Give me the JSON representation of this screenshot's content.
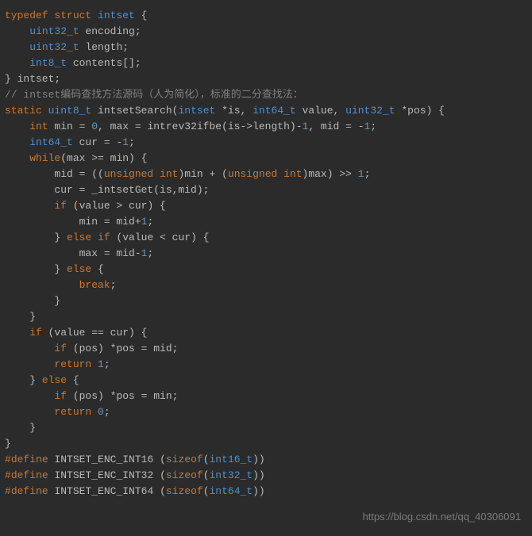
{
  "code": {
    "lines": [
      {
        "segments": [
          {
            "t": "typedef",
            "c": "kw"
          },
          {
            "t": " ",
            "c": "id"
          },
          {
            "t": "struct",
            "c": "kw"
          },
          {
            "t": " ",
            "c": "id"
          },
          {
            "t": "intset",
            "c": "typ"
          },
          {
            "t": " {",
            "c": "punc"
          }
        ]
      },
      {
        "segments": [
          {
            "t": "    ",
            "c": "id"
          },
          {
            "t": "uint32_t",
            "c": "typ"
          },
          {
            "t": " encoding;",
            "c": "id"
          }
        ]
      },
      {
        "segments": [
          {
            "t": "    ",
            "c": "id"
          },
          {
            "t": "uint32_t",
            "c": "typ"
          },
          {
            "t": " length;",
            "c": "id"
          }
        ]
      },
      {
        "segments": [
          {
            "t": "    ",
            "c": "id"
          },
          {
            "t": "int8_t",
            "c": "typ"
          },
          {
            "t": " contents[];",
            "c": "id"
          }
        ]
      },
      {
        "segments": [
          {
            "t": "} intset;",
            "c": "id"
          }
        ]
      },
      {
        "segments": [
          {
            "t": "",
            "c": "id"
          }
        ]
      },
      {
        "segments": [
          {
            "t": "// intset编码查找方法源码（人为简化），标准的二分查找法：",
            "c": "cmt"
          }
        ]
      },
      {
        "segments": [
          {
            "t": "static",
            "c": "kw"
          },
          {
            "t": " ",
            "c": "id"
          },
          {
            "t": "uint8_t",
            "c": "typ"
          },
          {
            "t": " ",
            "c": "id"
          },
          {
            "t": "intsetSearch",
            "c": "id"
          },
          {
            "t": "(",
            "c": "punc"
          },
          {
            "t": "intset",
            "c": "typ"
          },
          {
            "t": " *is, ",
            "c": "id"
          },
          {
            "t": "int64_t",
            "c": "typ"
          },
          {
            "t": " value, ",
            "c": "id"
          },
          {
            "t": "uint32_t",
            "c": "typ"
          },
          {
            "t": " *pos) {",
            "c": "id"
          }
        ]
      },
      {
        "segments": [
          {
            "t": "    ",
            "c": "id"
          },
          {
            "t": "int",
            "c": "kw"
          },
          {
            "t": " min = ",
            "c": "id"
          },
          {
            "t": "0",
            "c": "num"
          },
          {
            "t": ", max = intrev32ifbe(is->length)-",
            "c": "id"
          },
          {
            "t": "1",
            "c": "num"
          },
          {
            "t": ", mid = -",
            "c": "id"
          },
          {
            "t": "1",
            "c": "num"
          },
          {
            "t": ";",
            "c": "id"
          }
        ]
      },
      {
        "segments": [
          {
            "t": "    ",
            "c": "id"
          },
          {
            "t": "int64_t",
            "c": "typ"
          },
          {
            "t": " cur = -",
            "c": "id"
          },
          {
            "t": "1",
            "c": "num"
          },
          {
            "t": ";",
            "c": "id"
          }
        ]
      },
      {
        "segments": [
          {
            "t": "",
            "c": "id"
          }
        ]
      },
      {
        "segments": [
          {
            "t": "    ",
            "c": "id"
          },
          {
            "t": "while",
            "c": "ctrl"
          },
          {
            "t": "(max >= min) {",
            "c": "id"
          }
        ]
      },
      {
        "segments": [
          {
            "t": "        mid = ((",
            "c": "id"
          },
          {
            "t": "unsigned",
            "c": "kw"
          },
          {
            "t": " ",
            "c": "id"
          },
          {
            "t": "int",
            "c": "kw"
          },
          {
            "t": ")min + (",
            "c": "id"
          },
          {
            "t": "unsigned",
            "c": "kw"
          },
          {
            "t": " ",
            "c": "id"
          },
          {
            "t": "int",
            "c": "kw"
          },
          {
            "t": ")max) >> ",
            "c": "id"
          },
          {
            "t": "1",
            "c": "num"
          },
          {
            "t": ";",
            "c": "id"
          }
        ]
      },
      {
        "segments": [
          {
            "t": "        cur = _intsetGet(is,mid);",
            "c": "id"
          }
        ]
      },
      {
        "segments": [
          {
            "t": "        ",
            "c": "id"
          },
          {
            "t": "if",
            "c": "ctrl"
          },
          {
            "t": " (value > cur) {",
            "c": "id"
          }
        ]
      },
      {
        "segments": [
          {
            "t": "            min = mid+",
            "c": "id"
          },
          {
            "t": "1",
            "c": "num"
          },
          {
            "t": ";",
            "c": "id"
          }
        ]
      },
      {
        "segments": [
          {
            "t": "        } ",
            "c": "id"
          },
          {
            "t": "else",
            "c": "ctrl"
          },
          {
            "t": " ",
            "c": "id"
          },
          {
            "t": "if",
            "c": "ctrl"
          },
          {
            "t": " (value < cur) {",
            "c": "id"
          }
        ]
      },
      {
        "segments": [
          {
            "t": "            max = mid-",
            "c": "id"
          },
          {
            "t": "1",
            "c": "num"
          },
          {
            "t": ";",
            "c": "id"
          }
        ]
      },
      {
        "segments": [
          {
            "t": "        } ",
            "c": "id"
          },
          {
            "t": "else",
            "c": "ctrl"
          },
          {
            "t": " {",
            "c": "id"
          }
        ]
      },
      {
        "segments": [
          {
            "t": "            ",
            "c": "id"
          },
          {
            "t": "break",
            "c": "ctrl"
          },
          {
            "t": ";",
            "c": "id"
          }
        ]
      },
      {
        "segments": [
          {
            "t": "        }",
            "c": "id"
          }
        ]
      },
      {
        "segments": [
          {
            "t": "    }",
            "c": "id"
          }
        ]
      },
      {
        "segments": [
          {
            "t": "",
            "c": "id"
          }
        ]
      },
      {
        "segments": [
          {
            "t": "    ",
            "c": "id"
          },
          {
            "t": "if",
            "c": "ctrl"
          },
          {
            "t": " (value == cur) {",
            "c": "id"
          }
        ]
      },
      {
        "segments": [
          {
            "t": "        ",
            "c": "id"
          },
          {
            "t": "if",
            "c": "ctrl"
          },
          {
            "t": " (pos) *pos = mid;",
            "c": "id"
          }
        ]
      },
      {
        "segments": [
          {
            "t": "        ",
            "c": "id"
          },
          {
            "t": "return",
            "c": "ctrl"
          },
          {
            "t": " ",
            "c": "id"
          },
          {
            "t": "1",
            "c": "num"
          },
          {
            "t": ";",
            "c": "id"
          }
        ]
      },
      {
        "segments": [
          {
            "t": "    } ",
            "c": "id"
          },
          {
            "t": "else",
            "c": "ctrl"
          },
          {
            "t": " {",
            "c": "id"
          }
        ]
      },
      {
        "segments": [
          {
            "t": "        ",
            "c": "id"
          },
          {
            "t": "if",
            "c": "ctrl"
          },
          {
            "t": " (pos) *pos = min;",
            "c": "id"
          }
        ]
      },
      {
        "segments": [
          {
            "t": "        ",
            "c": "id"
          },
          {
            "t": "return",
            "c": "ctrl"
          },
          {
            "t": " ",
            "c": "id"
          },
          {
            "t": "0",
            "c": "num"
          },
          {
            "t": ";",
            "c": "id"
          }
        ]
      },
      {
        "segments": [
          {
            "t": "    }",
            "c": "id"
          }
        ]
      },
      {
        "segments": [
          {
            "t": "}",
            "c": "id"
          }
        ]
      },
      {
        "segments": [
          {
            "t": "",
            "c": "id"
          }
        ]
      },
      {
        "segments": [
          {
            "t": "#",
            "c": "kw"
          },
          {
            "t": "define",
            "c": "kw"
          },
          {
            "t": " ",
            "c": "id"
          },
          {
            "t": "INTSET_ENC_INT16",
            "c": "id"
          },
          {
            "t": " (",
            "c": "id"
          },
          {
            "t": "sizeof",
            "c": "kw"
          },
          {
            "t": "(",
            "c": "id"
          },
          {
            "t": "int16_t",
            "c": "typ"
          },
          {
            "t": "))",
            "c": "id"
          }
        ]
      },
      {
        "segments": [
          {
            "t": "#",
            "c": "kw"
          },
          {
            "t": "define",
            "c": "kw"
          },
          {
            "t": " ",
            "c": "id"
          },
          {
            "t": "INTSET_ENC_INT32",
            "c": "id"
          },
          {
            "t": " (",
            "c": "id"
          },
          {
            "t": "sizeof",
            "c": "kw"
          },
          {
            "t": "(",
            "c": "id"
          },
          {
            "t": "int32_t",
            "c": "typ"
          },
          {
            "t": "))",
            "c": "id"
          }
        ]
      },
      {
        "segments": [
          {
            "t": "#",
            "c": "kw"
          },
          {
            "t": "define",
            "c": "kw"
          },
          {
            "t": " ",
            "c": "id"
          },
          {
            "t": "INTSET_ENC_INT64",
            "c": "id"
          },
          {
            "t": " (",
            "c": "id"
          },
          {
            "t": "sizeof",
            "c": "kw"
          },
          {
            "t": "(",
            "c": "id"
          },
          {
            "t": "int64_t",
            "c": "typ"
          },
          {
            "t": "))",
            "c": "id"
          }
        ]
      }
    ]
  },
  "watermark": "https://blog.csdn.net/qq_40306091"
}
